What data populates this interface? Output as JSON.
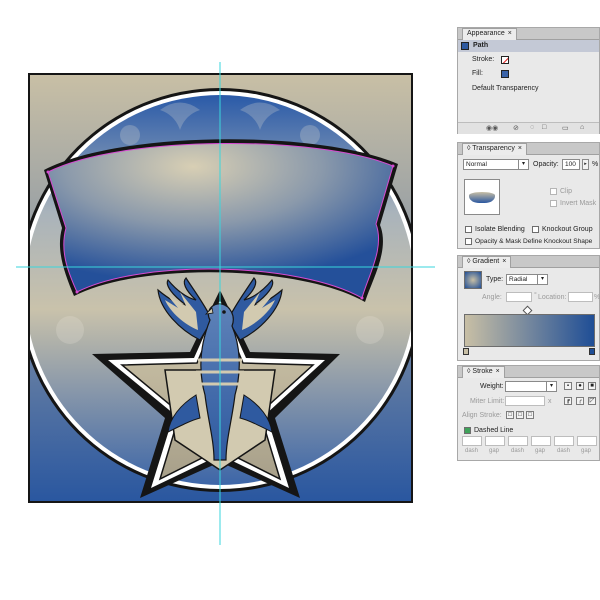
{
  "appearance": {
    "tab": "Appearance",
    "target": "Path",
    "stroke_label": "Stroke:",
    "fill_label": "Fill:",
    "default_transparency": "Default Transparency"
  },
  "transparency": {
    "tab": "Transparency",
    "blend_mode": "Normal",
    "opacity_label": "Opacity:",
    "opacity_value": "100",
    "opacity_unit": "%",
    "clip": "Clip",
    "invert_mask": "Invert Mask",
    "isolate_blending": "Isolate Blending",
    "knockout_group": "Knockout Group",
    "opacity_mask": "Opacity & Mask Define Knockout Shape"
  },
  "gradient": {
    "tab": "Gradient",
    "type_label": "Type:",
    "type_value": "Radial",
    "angle_label": "Angle:",
    "location_label": "Location:",
    "location_unit": "%",
    "color_start": "#c8bfa5",
    "color_end": "#1f4e96"
  },
  "stroke": {
    "tab": "Stroke",
    "weight_label": "Weight:",
    "miter_label": "Miter Limit:",
    "miter_unit": "x",
    "align_label": "Align Stroke:",
    "dashed_line": "Dashed Line",
    "dash_labels": [
      "dash",
      "gap",
      "dash",
      "gap",
      "dash",
      "gap"
    ]
  },
  "colors": {
    "artboard_frame": "#1a1a1a",
    "background_blue": "#2d5da5",
    "banner_light": "#d8cfb4",
    "guide": "#39d6dc",
    "path_selection": "#d64bd1"
  }
}
